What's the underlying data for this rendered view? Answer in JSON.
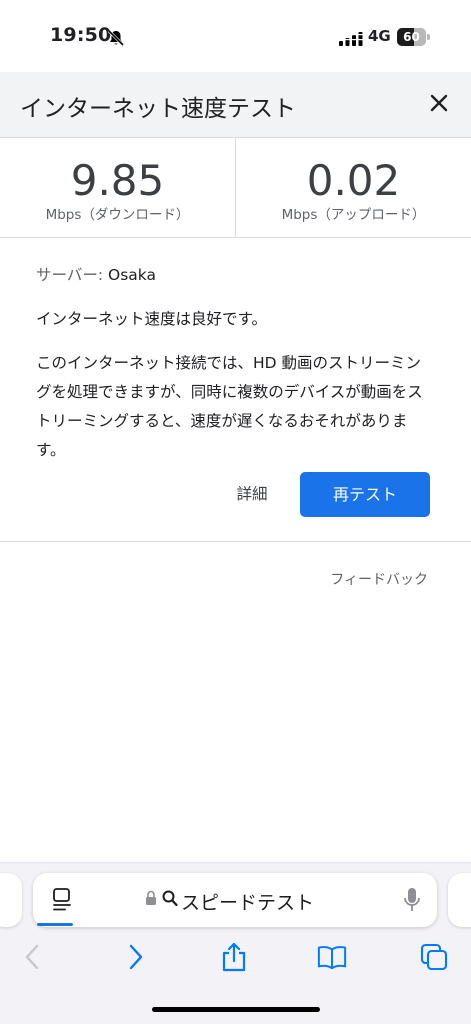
{
  "status_bar": {
    "time": "19:50",
    "network": "4G",
    "battery_level": 60,
    "battery_label": "60"
  },
  "header": {
    "title": "インターネット速度テスト"
  },
  "results": {
    "download": {
      "value": "9.85",
      "unit": "Mbps（ダウンロード）"
    },
    "upload": {
      "value": "0.02",
      "unit": "Mbps（アップロード）"
    }
  },
  "info": {
    "server_label": "サーバー: ",
    "server_value": "Osaka",
    "status": "インターネット速度は良好です。",
    "description": "このインターネット接続では、HD 動画のストリーミングを処理できますが、同時に複数のデバイスが動画をストリーミングすると、速度が遅くなるおそれがあります。"
  },
  "actions": {
    "details_label": "詳細",
    "retest_label": "再テスト"
  },
  "feedback_label": "フィードバック",
  "browser": {
    "address_text": "スピードテスト"
  },
  "colors": {
    "accent": "#1a73e8",
    "ios_blue": "#007aff"
  }
}
